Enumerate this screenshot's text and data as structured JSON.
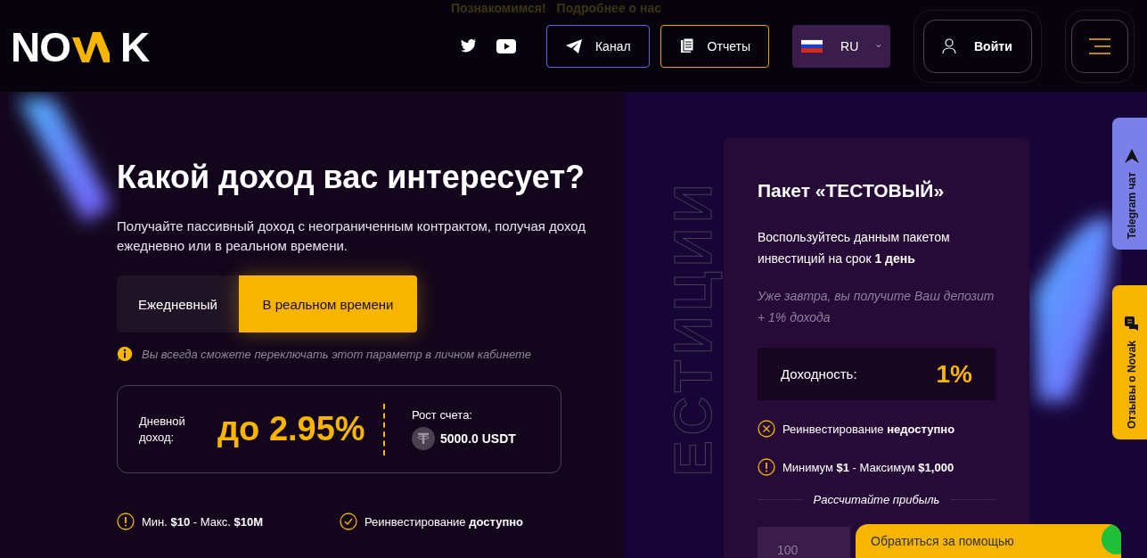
{
  "top_strip": {
    "links": [
      "Познакомимся!",
      "Подробнее о нас"
    ]
  },
  "header": {
    "logo": {
      "start": "NO",
      "end": "K"
    },
    "buttons": [
      {
        "label": "Канал",
        "kind": "telegram"
      },
      {
        "label": "Отчеты",
        "kind": "reports"
      }
    ],
    "language": "RU",
    "login": "Войти"
  },
  "hero": {
    "title": "Какой доход вас интересует?",
    "subtitle": "Получайте пассивный доход с неограниченным контрактом, получая доход ежедневно или в реальном времени.",
    "modes": [
      {
        "label": "Ежедневный",
        "selected": false
      },
      {
        "label": "В реальном времени",
        "selected": true
      }
    ],
    "note": "Вы всегда сможете переключать этот параметр в личном кабинете",
    "stats": {
      "label": "Дневной доход:",
      "value": "до 2.95%",
      "growth_label": "Рост счета:",
      "growth_value": "5000.0 USDT"
    },
    "features": [
      {
        "kind": "warning",
        "text": "Мин. **$10** - Макс. **$10M**"
      },
      {
        "kind": "check",
        "text": "Реинвестирование **доступно**"
      }
    ]
  },
  "decor_text": "ЕСТИЦИИ",
  "package": {
    "title": "Пакет «ТЕСТОВЫЙ»",
    "description": "Воспользуйтесь данным пакетом инвестиций на срок **1 день**",
    "note": "Уже завтра, вы получите Ваш депозит + 1% дохода",
    "yield_label": "Доходность:",
    "yield_value": "1%",
    "features": [
      {
        "kind": "cross",
        "text": "Реинвестирование **недоступно**"
      },
      {
        "kind": "warning",
        "text": "Минимум **$1** - Максимум **$1,000**"
      }
    ],
    "calc_label": "Рассчитайте прибыль",
    "amount": "100"
  },
  "side_tabs": [
    {
      "label": "Telegram чат",
      "kind": "telegram"
    },
    {
      "label": "Отзывы о Novak",
      "kind": "reviews"
    }
  ],
  "help_widget": "Обратиться за помощью"
}
